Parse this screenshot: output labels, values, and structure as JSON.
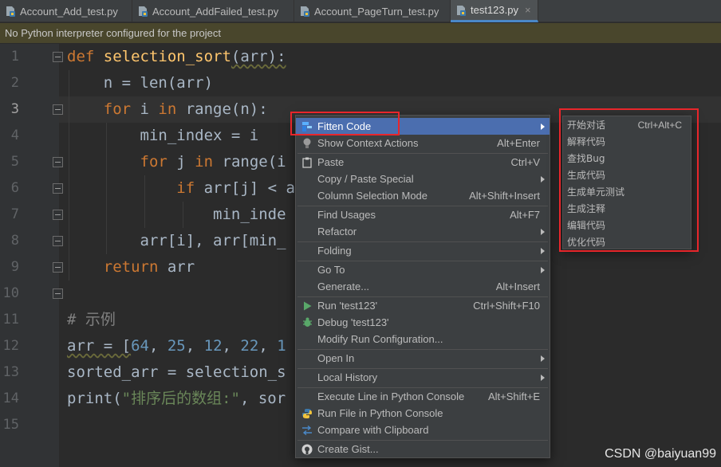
{
  "tabs": [
    {
      "label": "Account_Add_test.py",
      "active": false
    },
    {
      "label": "Account_AddFailed_test.py",
      "active": false
    },
    {
      "label": "Account_PageTurn_test.py",
      "active": false
    },
    {
      "label": "test123.py",
      "active": true,
      "close": "×"
    }
  ],
  "banner": {
    "text": "No Python interpreter configured for the project"
  },
  "editor": {
    "current_line": 3,
    "line_numbers": [
      "1",
      "2",
      "3",
      "4",
      "5",
      "6",
      "7",
      "8",
      "9",
      "10",
      "11",
      "12",
      "13",
      "14",
      "15"
    ],
    "code": {
      "l1_def": "def",
      "l1_name": " selection_sort",
      "l1_rest": "(arr):",
      "l2": "    n = len(arr)",
      "l3_for": "    for",
      "l3_mid": " i ",
      "l3_in": "in",
      "l3_rest": " range(n):",
      "l4": "        min_index = i",
      "l5_for": "        for",
      "l5_mid": " j ",
      "l5_in": "in",
      "l5_rest": " range(i",
      "l6_if": "            if",
      "l6_rest": " arr[j] < a",
      "l7": "                min_inde",
      "l8": "        arr[i], arr[min_",
      "l9_ret": "    return",
      "l9_rest": " arr",
      "l11": "# 示例",
      "l12_a": "arr = [",
      "l12_n1": "64",
      "l12_c1": ", ",
      "l12_n2": "25",
      "l12_c2": ", ",
      "l12_n3": "12",
      "l12_c3": ", ",
      "l12_n4": "22",
      "l12_c4": ", ",
      "l12_n5": "1",
      "l13": "sorted_arr = selection_s",
      "l14_a": "print(",
      "l14_str": "\"排序后的数组:\"",
      "l14_b": ", sor"
    }
  },
  "context_menu": {
    "items": [
      {
        "label": "Fitten Code",
        "submenu": true,
        "selected": true,
        "icon": "fitten-icon"
      },
      {
        "label": "Show Context Actions",
        "shortcut": "Alt+Enter",
        "icon": "bulb-icon"
      },
      {
        "label": "Paste",
        "shortcut": "Ctrl+V",
        "icon": "clipboard-icon"
      },
      {
        "label": "Copy / Paste Special",
        "submenu": true
      },
      {
        "label": "Column Selection Mode",
        "shortcut": "Alt+Shift+Insert"
      },
      {
        "label": "Find Usages",
        "shortcut": "Alt+F7"
      },
      {
        "label": "Refactor",
        "submenu": true
      },
      {
        "label": "Folding",
        "submenu": true
      },
      {
        "label": "Go To",
        "submenu": true
      },
      {
        "label": "Generate...",
        "shortcut": "Alt+Insert"
      },
      {
        "label": "Run 'test123'",
        "shortcut": "Ctrl+Shift+F10",
        "icon": "run-icon"
      },
      {
        "label": "Debug 'test123'",
        "icon": "debug-icon"
      },
      {
        "label": "Modify Run Configuration..."
      },
      {
        "label": "Open In",
        "submenu": true
      },
      {
        "label": "Local History",
        "submenu": true
      },
      {
        "label": "Execute Line in Python Console",
        "shortcut": "Alt+Shift+E"
      },
      {
        "label": "Run File in Python Console",
        "icon": "python-icon"
      },
      {
        "label": "Compare with Clipboard",
        "icon": "compare-icon"
      },
      {
        "label": "Create Gist...",
        "icon": "github-icon"
      }
    ]
  },
  "submenu": {
    "items": [
      {
        "label": "开始对话",
        "shortcut": "Ctrl+Alt+C"
      },
      {
        "label": "解释代码"
      },
      {
        "label": "查找Bug"
      },
      {
        "label": "生成代码"
      },
      {
        "label": "生成单元测试"
      },
      {
        "label": "生成注释"
      },
      {
        "label": "编辑代码"
      },
      {
        "label": "优化代码"
      }
    ]
  },
  "watermark": "CSDN @baiyuan99",
  "colors": {
    "highlight_box": "#e8262b",
    "menu_selection": "#4b6eaf",
    "keyword": "#cc7832",
    "function_name": "#ffc66d",
    "number": "#6897bb",
    "string": "#6a8759"
  }
}
